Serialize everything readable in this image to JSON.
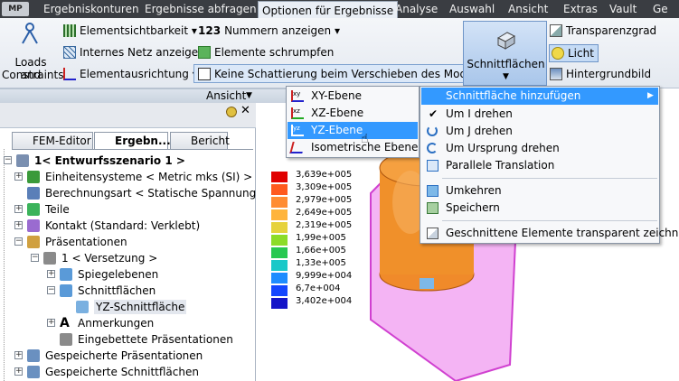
{
  "app_badge": "MP",
  "tabs": [
    "Ergebniskonturen",
    "Ergebnisse abfragen",
    "Optionen für Ergebnisse",
    "Analyse",
    "Auswahl",
    "Ansicht",
    "Extras",
    "Vault",
    "Ge"
  ],
  "ribbon": {
    "loads_label_1": "Loads and",
    "loads_label_2": "Constraints",
    "elementsichtbarkeit": "Elementsichtbarkeit",
    "nummern_icon_text": "123",
    "nummern": "Nummern anzeigen",
    "internes_netz": "Internes Netz anzeigen",
    "schrumpfen": "Elemente schrumpfen",
    "ausrichtung": "Elementausrichtung",
    "keine_schattierung": "Keine Schattierung beim Verschieben des Modells",
    "schnittflaechen": "Schnittflächen",
    "transparenzgrad": "Transparenzgrad",
    "licht": "Licht",
    "hintergrundbild": "Hintergrundbild",
    "group_ansicht": "Ansicht"
  },
  "browser": {
    "tabs": [
      "FEM-Editor",
      "Ergebn...",
      "Bericht"
    ],
    "tree": [
      "1< Entwurfsszenario 1 >",
      "Einheitensysteme < Metric mks (SI) >",
      "Berechnungsart < Statische Spannung",
      "Teile",
      "Kontakt (Standard: Verklebt)",
      "Präsentationen",
      "1 < Versetzung >",
      "Spiegelebenen",
      "Schnittflächen",
      "YZ-Schnittfläche",
      "Anmerkungen",
      "Eingebettete Präsentationen",
      "Gespeicherte Präsentationen",
      "Gespeicherte Schnittflächen"
    ]
  },
  "legend": {
    "values": [
      "3,639e+005",
      "3,309e+005",
      "2,979e+005",
      "2,649e+005",
      "2,319e+005",
      "1,99e+005",
      "1,66e+005",
      "1,33e+005",
      "9,999e+004",
      "6,7e+004",
      "3,402e+004"
    ],
    "colors": [
      "#e00000",
      "#ff5a1e",
      "#ff8c32",
      "#ffb43c",
      "#e6d23c",
      "#8cdc28",
      "#28c850",
      "#19c8c8",
      "#1e8cff",
      "#1446ff",
      "#1414c8"
    ]
  },
  "submenu": {
    "items": [
      "XY-Ebene",
      "XZ-Ebene",
      "YZ-Ebene",
      "Isometrische Ebene"
    ]
  },
  "context_menu": {
    "items": [
      "Schnittfläche hinzufügen",
      "Um I drehen",
      "Um J drehen",
      "Um Ursprung drehen",
      "Parallele Translation",
      "Umkehren",
      "Speichern",
      "Geschnittene Elemente transparent zeichnen"
    ]
  }
}
